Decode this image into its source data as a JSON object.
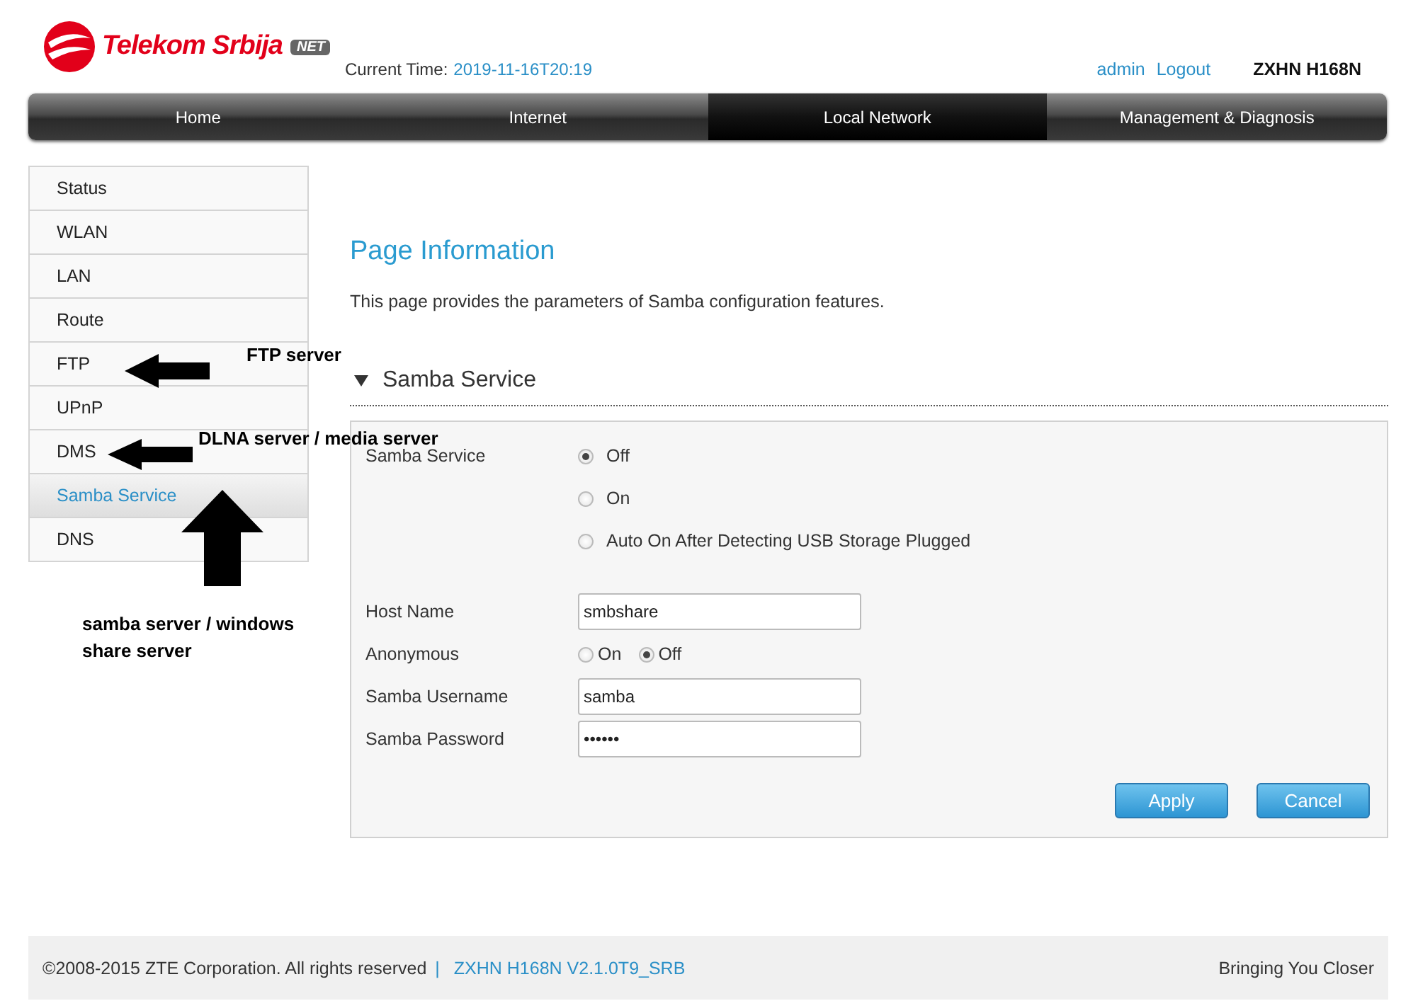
{
  "header": {
    "logo": {
      "name": "Telekom Srbija",
      "badge": "NET"
    },
    "current_time_label": "Current Time:",
    "current_time": "2019-11-16T20:19",
    "user": "admin",
    "logout": "Logout",
    "model": "ZXHN H168N"
  },
  "nav": [
    {
      "label": "Home",
      "selected": false
    },
    {
      "label": "Internet",
      "selected": false
    },
    {
      "label": "Local Network",
      "selected": true
    },
    {
      "label": "Management & Diagnosis",
      "selected": false
    }
  ],
  "sidebar": {
    "items": [
      {
        "label": "Status",
        "selected": false
      },
      {
        "label": "WLAN",
        "selected": false
      },
      {
        "label": "LAN",
        "selected": false
      },
      {
        "label": "Route",
        "selected": false
      },
      {
        "label": "FTP",
        "selected": false
      },
      {
        "label": "UPnP",
        "selected": false
      },
      {
        "label": "DMS",
        "selected": false
      },
      {
        "label": "Samba Service",
        "selected": true
      },
      {
        "label": "DNS",
        "selected": false
      }
    ]
  },
  "page": {
    "title": "Page Information",
    "description": "This page provides the parameters of Samba configuration features.",
    "section": {
      "title": "Samba Service",
      "expanded": true
    }
  },
  "form": {
    "service": {
      "label": "Samba Service",
      "options": [
        {
          "label": "Off",
          "selected": true
        },
        {
          "label": "On",
          "selected": false
        },
        {
          "label": "Auto On After Detecting USB Storage Plugged",
          "selected": false
        }
      ]
    },
    "host_name": {
      "label": "Host Name",
      "value": "smbshare"
    },
    "anonymous": {
      "label": "Anonymous",
      "options": [
        {
          "label": "On",
          "selected": false
        },
        {
          "label": "Off",
          "selected": true
        }
      ]
    },
    "username": {
      "label": "Samba Username",
      "value": "samba"
    },
    "password": {
      "label": "Samba Password",
      "value": "••••••"
    },
    "buttons": [
      "Apply",
      "Cancel"
    ]
  },
  "annotations": [
    {
      "kind": "left_arrow"
    },
    {
      "kind": "label",
      "text": "FTP server"
    },
    {
      "kind": "left_arrow"
    },
    {
      "kind": "label",
      "text": "DLNA server / media server"
    },
    {
      "kind": "up_arrow"
    },
    {
      "kind": "label",
      "text": "samba server / windows share server"
    }
  ],
  "footer": {
    "copyright": "©2008-2015 ZTE Corporation. All rights reserved",
    "separator": "|",
    "version": "ZXHN H168N V2.1.0T9_SRB",
    "slogan": "Bringing You Closer"
  }
}
